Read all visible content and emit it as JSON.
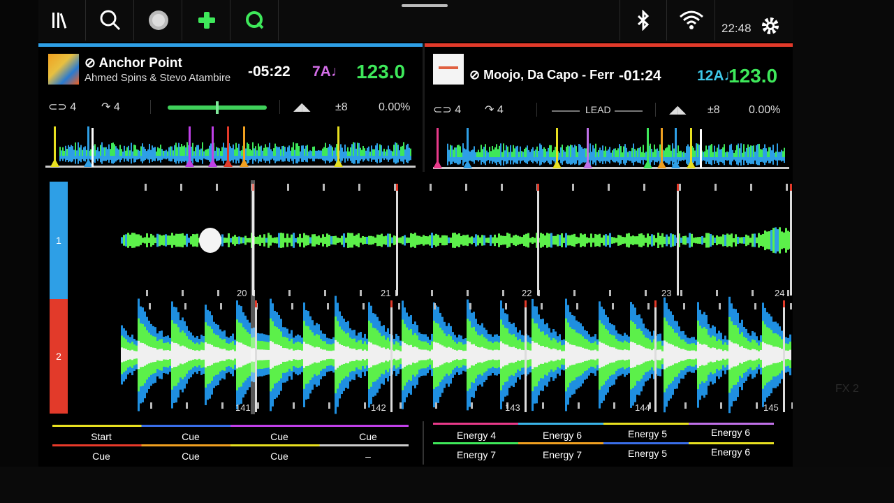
{
  "topbar": {
    "icons": [
      "library-icon",
      "search-icon",
      "record-icon",
      "add-icon",
      "quantize-icon",
      "bluetooth-icon",
      "wifi-icon",
      "gear-icon"
    ],
    "clock": "22:48"
  },
  "deck_a": {
    "color": "#2e9fe6",
    "title": "Anchor Point",
    "artist": "Ahmed Spins & Stevo Atambire",
    "time": "-05:22",
    "key": "7A♩",
    "key_color": "#d46ee8",
    "bpm": "123.0",
    "loop": "4",
    "jump": "4",
    "pitch_range": "±8",
    "pitch": "0.00%"
  },
  "deck_b": {
    "color": "#e23a2a",
    "title": "Moojo, Da Capo - Ferr",
    "time": "-01:24",
    "key": "12A♩",
    "key_color": "#3ec8e8",
    "bpm": "123.0",
    "loop": "4",
    "jump": "4",
    "sync_label": "LEAD",
    "pitch_range": "±8",
    "pitch": "0.00%"
  },
  "main_waveform": {
    "deck1_label": "1",
    "deck2_label": "2",
    "deck1_beats": [
      "20",
      "21",
      "22",
      "23",
      "24"
    ],
    "deck2_beats": [
      "141",
      "142",
      "143",
      "144",
      "145"
    ]
  },
  "pads_a": {
    "row1": [
      "Start",
      "Cue",
      "Cue",
      "Cue"
    ],
    "row2": [
      "Cue",
      "Cue",
      "Cue",
      "–"
    ]
  },
  "pads_b": {
    "row1": [
      "Energy 4",
      "Energy 6",
      "Energy 5",
      "Energy 6"
    ],
    "row2": [
      "Energy 7",
      "Energy 7",
      "Energy 5",
      "Energy 6"
    ]
  },
  "bezel_label": "FX 2"
}
